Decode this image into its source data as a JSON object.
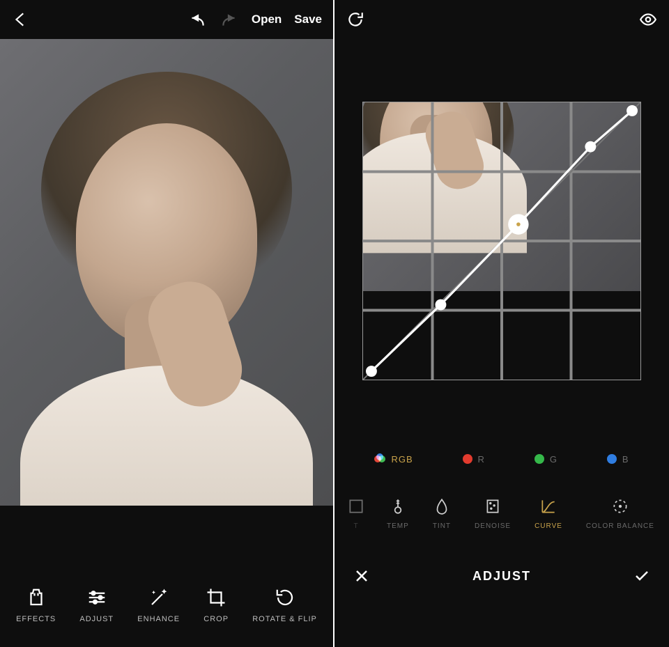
{
  "left": {
    "topbar": {
      "open": "Open",
      "save": "Save"
    },
    "tools": [
      {
        "id": "effects",
        "label": "EFFECTS"
      },
      {
        "id": "adjust",
        "label": "ADJUST"
      },
      {
        "id": "enhance",
        "label": "ENHANCE"
      },
      {
        "id": "crop",
        "label": "CROP"
      },
      {
        "id": "rotateflip",
        "label": "ROTATE & FLIP"
      }
    ]
  },
  "right": {
    "channels": [
      {
        "id": "rgb",
        "label": "RGB",
        "active": true
      },
      {
        "id": "r",
        "label": "R",
        "color": "#e23b2e"
      },
      {
        "id": "g",
        "label": "G",
        "color": "#35b84a"
      },
      {
        "id": "b",
        "label": "B",
        "color": "#2f7de1"
      }
    ],
    "adjust_tools": [
      {
        "id": "cut",
        "label": "T"
      },
      {
        "id": "temp",
        "label": "TEMP"
      },
      {
        "id": "tint",
        "label": "TINT"
      },
      {
        "id": "denoise",
        "label": "DENOISE"
      },
      {
        "id": "curve",
        "label": "CURVE",
        "active": true
      },
      {
        "id": "colorbalance",
        "label": "COLOR BALANCE"
      }
    ],
    "panel_title": "ADJUST",
    "curve_points": [
      {
        "x": 0.03,
        "y": 0.97
      },
      {
        "x": 0.28,
        "y": 0.73
      },
      {
        "x": 0.56,
        "y": 0.44,
        "selected": true
      },
      {
        "x": 0.82,
        "y": 0.16
      },
      {
        "x": 0.97,
        "y": 0.03
      }
    ]
  }
}
